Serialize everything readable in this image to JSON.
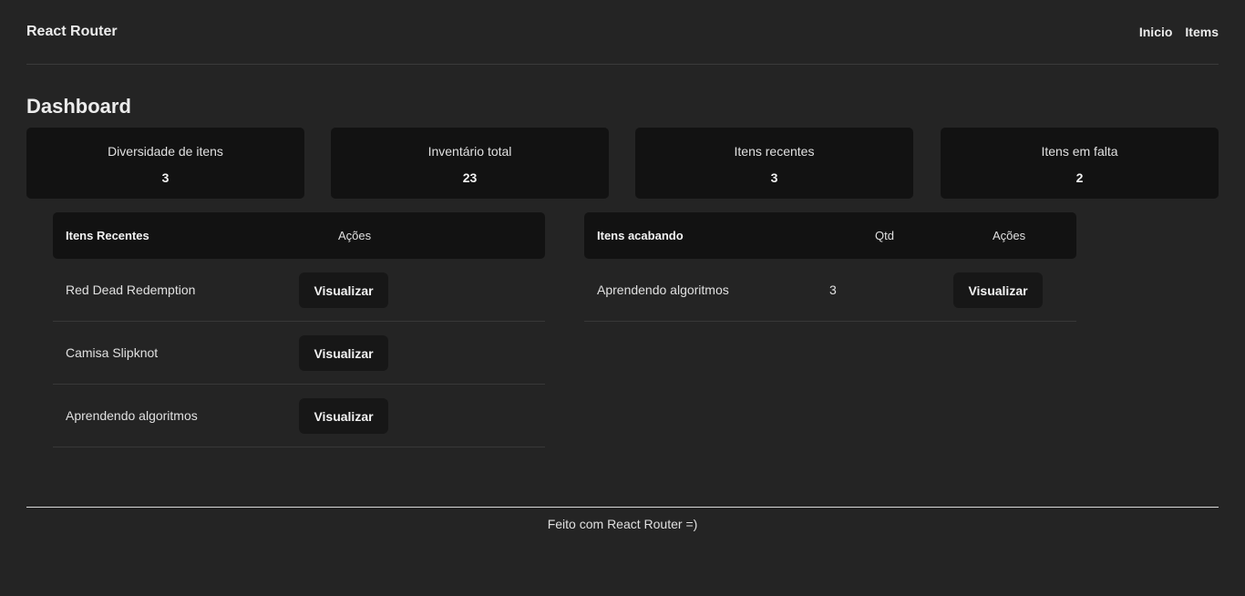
{
  "header": {
    "brand": "React Router",
    "nav": [
      {
        "label": "Inicio"
      },
      {
        "label": "Items"
      }
    ]
  },
  "page_title": "Dashboard",
  "stats": [
    {
      "label": "Diversidade de itens",
      "value": "3"
    },
    {
      "label": "Inventário total",
      "value": "23"
    },
    {
      "label": "Itens recentes",
      "value": "3"
    },
    {
      "label": "Itens em falta",
      "value": "2"
    }
  ],
  "recent_table": {
    "headers": [
      "Itens Recentes",
      "Ações"
    ],
    "rows": [
      {
        "name": "Red Dead Redemption",
        "action": "Visualizar"
      },
      {
        "name": "Camisa Slipknot",
        "action": "Visualizar"
      },
      {
        "name": "Aprendendo algoritmos",
        "action": "Visualizar"
      }
    ]
  },
  "low_stock_table": {
    "headers": [
      "Itens acabando",
      "Qtd",
      "Ações"
    ],
    "rows": [
      {
        "name": "Aprendendo algoritmos",
        "qty": "3",
        "action": "Visualizar"
      }
    ]
  },
  "footer": {
    "text": "Feito com React Router =)"
  }
}
